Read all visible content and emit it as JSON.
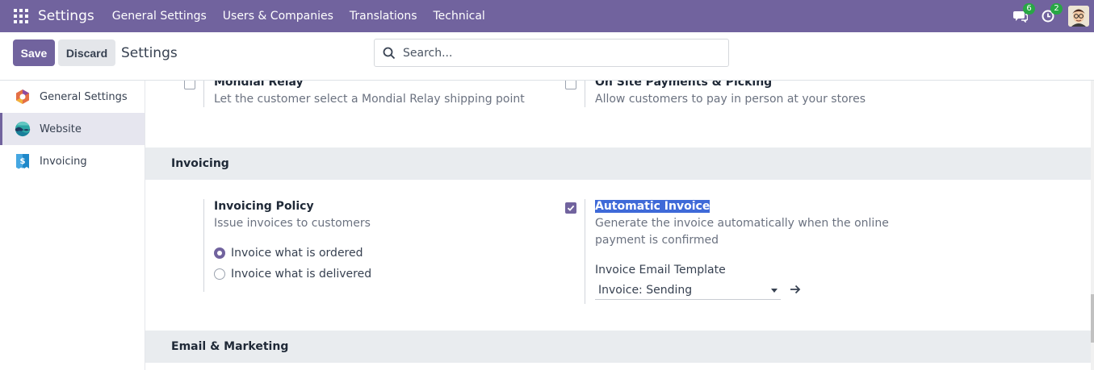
{
  "navbar": {
    "brand": "Settings",
    "menu": [
      "General Settings",
      "Users & Companies",
      "Translations",
      "Technical"
    ],
    "messages_count": "6",
    "activities_count": "2",
    "color": "#71639e"
  },
  "control_panel": {
    "save_label": "Save",
    "discard_label": "Discard",
    "title": "Settings",
    "search_placeholder": "Search..."
  },
  "sidebar": {
    "items": [
      {
        "label": "General Settings",
        "icon": "odoo-settings-icon",
        "active": false
      },
      {
        "label": "Website",
        "icon": "website-icon",
        "active": true
      },
      {
        "label": "Invoicing",
        "icon": "invoicing-icon",
        "active": false
      }
    ]
  },
  "top_settings": {
    "mondial_relay": {
      "title": "Mondial Relay",
      "description": "Let the customer select a Mondial Relay shipping point",
      "checked": false
    },
    "onsite_payments": {
      "title": "On Site Payments & Picking",
      "description": "Allow customers to pay in person at your stores",
      "checked": false
    }
  },
  "invoicing_section": {
    "header": "Invoicing",
    "policy": {
      "title": "Invoicing Policy",
      "description": "Issue invoices to customers",
      "options": [
        "Invoice what is ordered",
        "Invoice what is delivered"
      ],
      "selected_index": 0
    },
    "automatic_invoice": {
      "title": "Automatic Invoice",
      "description": "Generate the invoice automatically when the online payment is confirmed",
      "checked": true,
      "template_label": "Invoice Email Template",
      "template_value": "Invoice: Sending"
    }
  },
  "email_marketing_section": {
    "header": "Email & Marketing"
  }
}
